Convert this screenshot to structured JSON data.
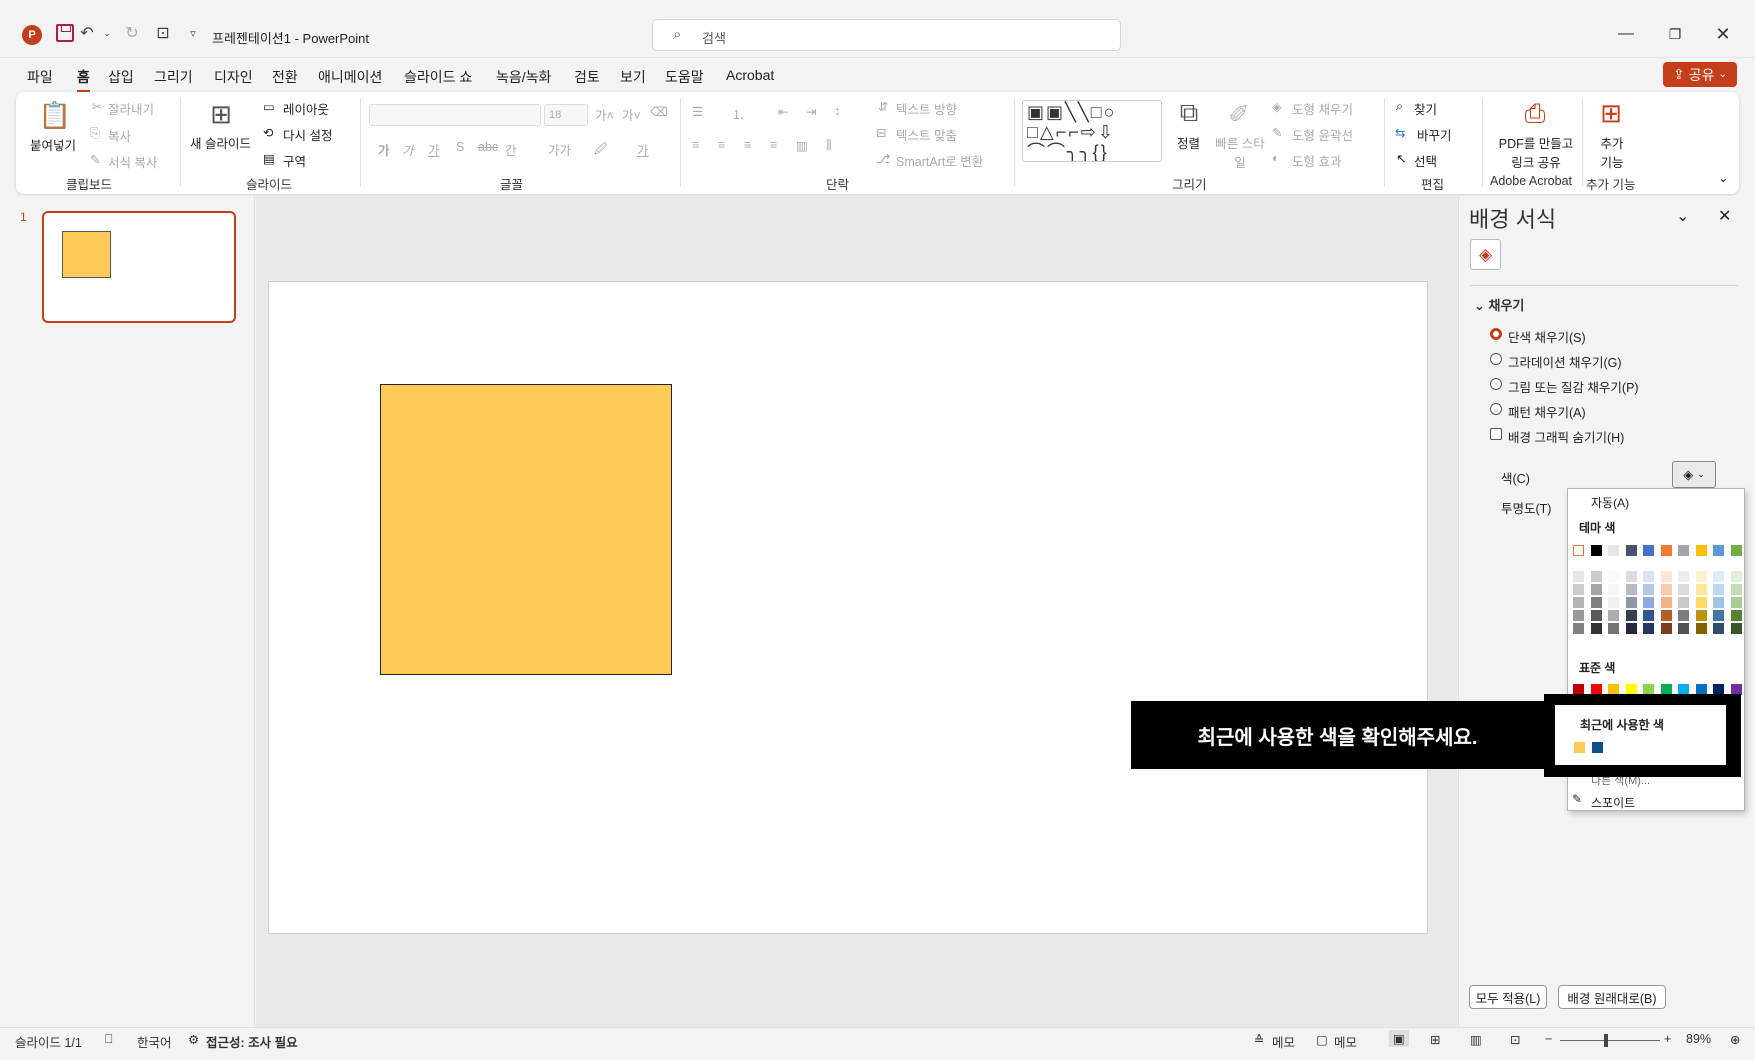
{
  "titlebar": {
    "doc_title": "프레젠테이션1  -  PowerPoint",
    "search_placeholder": "검색",
    "logo_letter": "P"
  },
  "menu": [
    "파일",
    "홈",
    "삽입",
    "그리기",
    "디자인",
    "전환",
    "애니메이션",
    "슬라이드 쇼",
    "녹음/녹화",
    "검토",
    "보기",
    "도움말",
    "Acrobat"
  ],
  "share_label": "공유",
  "ribbon": {
    "paste": "붙여넣기",
    "cut": "잘라내기",
    "copy": "복사",
    "format_painter": "서식 복사",
    "new_slide": "새 슬라이드",
    "layout": "레이아웃",
    "reset": "다시 설정",
    "section": "구역",
    "font_size": "18",
    "text_direction": "텍스트 방향",
    "align_text": "텍스트 맞춤",
    "smartart": "SmartArt로 변환",
    "arrange": "정렬",
    "quick_styles": "빠른 스타일",
    "shape_fill": "도형 채우기",
    "shape_outline": "도형 윤곽선",
    "shape_effects": "도형 효과",
    "find": "찾기",
    "replace": "바꾸기",
    "select": "선택",
    "pdf": "PDF를 만들고 링크 공유",
    "addins": "추가 기능",
    "groups": {
      "clipboard": "클립보드",
      "slides": "슬라이드",
      "font": "글꼴",
      "paragraph": "단락",
      "drawing": "그리기",
      "editing": "편집",
      "acrobat": "Adobe Acrobat",
      "addins": "추가 기능"
    }
  },
  "thumbnail": {
    "number": "1"
  },
  "pane": {
    "title": "배경 서식",
    "fill_section": "채우기",
    "options": {
      "solid": "단색 채우기(S)",
      "gradient": "그라데이션 채우기(G)",
      "picture": "그림 또는 질감 채우기(P)",
      "pattern": "패턴 채우기(A)",
      "hide_graphics": "배경 그래픽 숨기기(H)"
    },
    "color_label": "색(C)",
    "transparency_label": "투명도(T)",
    "apply_all": "모두 적용(L)",
    "reset_bg": "배경 원래대로(B)"
  },
  "color_dropdown": {
    "auto": "자동(A)",
    "theme_colors": "테마 색",
    "standard_colors": "표준 색",
    "recent_colors": "최근에 사용한 색",
    "more_colors": "다른 색(M)...",
    "eyedropper": "스포이트",
    "theme_row": [
      "#ffffff",
      "#000000",
      "#e7e6e6",
      "#44546a",
      "#4472c4",
      "#ed7d31",
      "#a5a5a5",
      "#ffc000",
      "#5b9bd5",
      "#70ad47"
    ],
    "standard_row": [
      "#c00000",
      "#ff0000",
      "#ffc000",
      "#ffff00",
      "#92d050",
      "#00b050",
      "#00b0f0",
      "#0070c0",
      "#002060",
      "#7030a0"
    ],
    "recent": [
      "#ffca55",
      "#0b4f8a"
    ]
  },
  "tooltip": "최근에 사용한 색을 확인해주세요.",
  "status": {
    "slide": "슬라이드 1/1",
    "language": "한국어",
    "accessibility": "접근성: 조사 필요",
    "notes": "메모",
    "comments": "메모",
    "zoom": "89%"
  },
  "colors": {
    "accent": "#c43e1c",
    "shape_fill": "#ffca55"
  }
}
